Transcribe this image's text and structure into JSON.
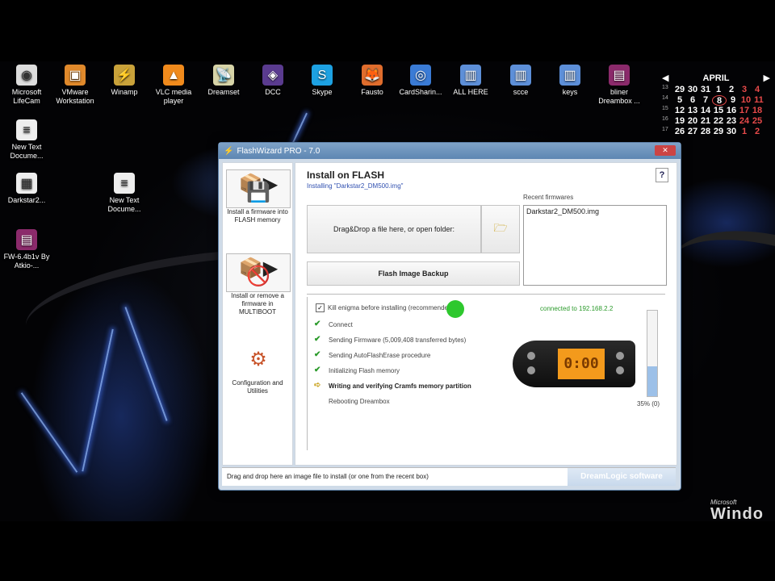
{
  "desktop_icons": [
    {
      "label": "Microsoft LifeCam",
      "icon": "webcam-icon",
      "color": "#dddddd"
    },
    {
      "label": "VMware Workstation",
      "icon": "vmware-icon",
      "color": "#e0892b"
    },
    {
      "label": "Winamp",
      "icon": "winamp-icon",
      "color": "#c9a23a"
    },
    {
      "label": "VLC media player",
      "icon": "vlc-icon",
      "color": "#f08a1c"
    },
    {
      "label": "Dreamset",
      "icon": "satellite-dish-icon",
      "color": "#d7d4a8"
    },
    {
      "label": "DCC",
      "icon": "dcc-icon",
      "color": "#5a3b8f"
    },
    {
      "label": "Skype",
      "icon": "skype-icon",
      "color": "#1da1e2"
    },
    {
      "label": "Fausto",
      "icon": "fox-icon",
      "color": "#e06d2d"
    },
    {
      "label": "CardSharin...",
      "icon": "globe-icon",
      "color": "#3a7bd5"
    },
    {
      "label": "ALL HERE",
      "icon": "folder-icon",
      "color": "#5d8fd8"
    },
    {
      "label": "scce",
      "icon": "folder-icon",
      "color": "#5d8fd8"
    },
    {
      "label": "keys",
      "icon": "folder-icon",
      "color": "#5d8fd8"
    },
    {
      "label": "bliner Dreambox ...",
      "icon": "winrar-icon",
      "color": "#8b2a6b"
    },
    {
      "label": "New Text Docume...",
      "icon": "text-document-icon",
      "color": "#eeeeee"
    },
    {
      "label": "Darkstar2...",
      "icon": "document-icon",
      "color": "#eeeeee"
    },
    {
      "label": "New Text Docume...",
      "icon": "text-document-icon",
      "color": "#eeeeee"
    },
    {
      "label": "FW-6.4b1v By Atkio-...",
      "icon": "winrar-icon",
      "color": "#8b2a6b"
    }
  ],
  "calendar": {
    "month": "APRIL",
    "weeks": [
      {
        "wk": "13",
        "days": [
          "29",
          "30",
          "31",
          "1",
          "2",
          "3",
          "4"
        ]
      },
      {
        "wk": "14",
        "days": [
          "5",
          "6",
          "7",
          "8",
          "9",
          "10",
          "11"
        ]
      },
      {
        "wk": "15",
        "days": [
          "12",
          "13",
          "14",
          "15",
          "16",
          "17",
          "18"
        ]
      },
      {
        "wk": "16",
        "days": [
          "19",
          "20",
          "21",
          "22",
          "23",
          "24",
          "25"
        ]
      },
      {
        "wk": "17",
        "days": [
          "26",
          "27",
          "28",
          "29",
          "30",
          "1",
          "2"
        ]
      }
    ]
  },
  "window": {
    "title": "FlashWizard PRO - 7.0",
    "close_label": "✕",
    "help_label": "?",
    "header_title": "Install on FLASH",
    "header_subtitle": "Installing \"Darkstar2_DM500.img\"",
    "drop_label": "Drag&Drop a file here, or open folder:",
    "backup_label": "Flash Image Backup",
    "recent_label": "Recent firmwares",
    "recent_items": [
      "Darkstar2_DM500.img"
    ],
    "kill_label": "Kill enigma before installing (recommended)",
    "connected_label": "connected to 192.168.2.2",
    "tasks": [
      {
        "label": "Connect",
        "state": "done"
      },
      {
        "label": "Sending Firmware (5,009,408 transferred bytes)",
        "state": "done"
      },
      {
        "label": "Sending AutoFlashErase procedure",
        "state": "done"
      },
      {
        "label": "Initializing Flash memory",
        "state": "done"
      },
      {
        "label": "Writing and verifying Cramfs memory partition",
        "state": "current"
      },
      {
        "label": "Rebooting Dreambox",
        "state": "pending"
      }
    ],
    "progress_label": "35% (0)",
    "progress_fraction": 0.35,
    "device_display": "0:00",
    "left_tools": [
      {
        "label": "Install a firmware into FLASH memory",
        "icon": "flash-install-icon"
      },
      {
        "label": "Install or remove a firmware in MULTIBOOT",
        "icon": "multiboot-icon"
      },
      {
        "label": "Configuration and Utilities",
        "icon": "utilities-icon"
      }
    ],
    "status_text": "Drag and drop here an image file to install (or one from the recent box)",
    "brand_label": "DreamLogic software"
  },
  "watermark": {
    "line1": "Microsoft",
    "line2": "Windo"
  }
}
